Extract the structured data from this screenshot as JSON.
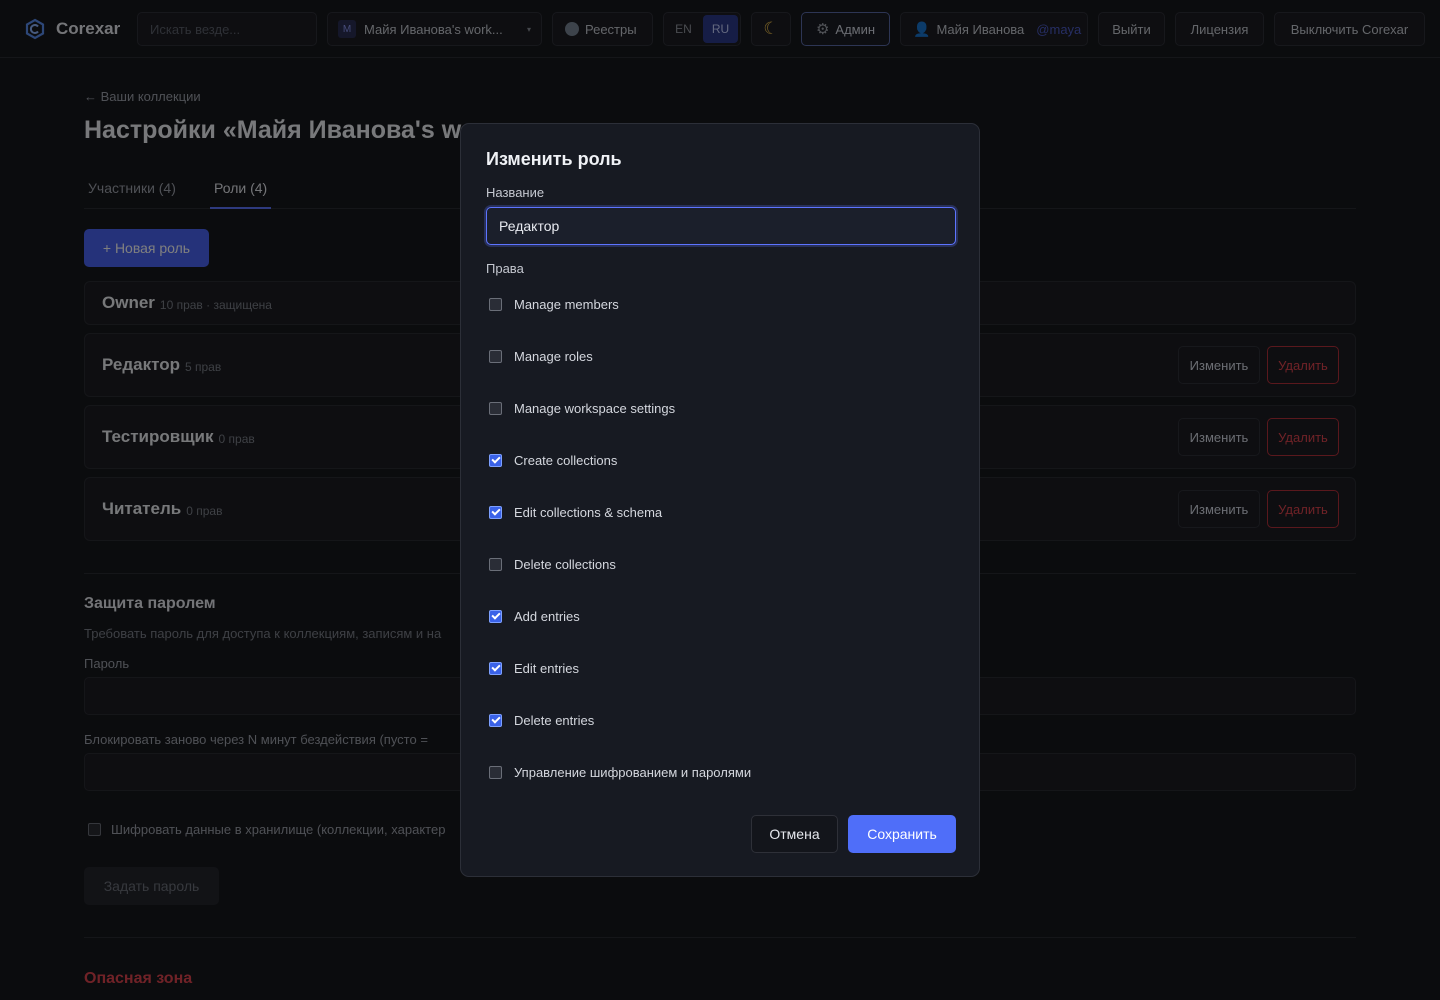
{
  "topbar": {
    "brand": "Corexar",
    "search_placeholder": "Искать везде...",
    "workspace_initial": "M",
    "workspace_name": "Майя Иванова's work...",
    "workspace_caret": "▾",
    "registries": "Реестры",
    "lang_en": "EN",
    "lang_ru": "RU",
    "theme_icon": "☾",
    "admin_icon": "⚙",
    "admin": "Админ",
    "user_icon": "👤",
    "user_name": "Майя Иванова",
    "user_handle": "@maya",
    "logout": "Выйти",
    "license": "Лицензия",
    "shutdown": "Выключить Corexar"
  },
  "page": {
    "back_link": "← Ваши коллекции",
    "title": "Настройки «Майя Иванова's w",
    "tabs": [
      {
        "label": "Участники (4)"
      },
      {
        "label": "Роли (4)"
      }
    ],
    "new_role": "+ Новая роль",
    "roles": [
      {
        "name": "Owner",
        "meta": "10 прав · защищена"
      },
      {
        "name": "Редактор",
        "meta": "5 прав",
        "edit": "Изменить",
        "delete": "Удалить"
      },
      {
        "name": "Тестировщик",
        "meta": "0 прав",
        "edit": "Изменить",
        "delete": "Удалить"
      },
      {
        "name": "Читатель",
        "meta": "0 прав",
        "edit": "Изменить",
        "delete": "Удалить"
      }
    ],
    "password_section": {
      "title": "Защита паролем",
      "desc": "Требовать пароль для доступа к коллекциям, записям и на",
      "password_label": "Пароль",
      "relock_label": "Блокировать заново через N минут бездействия (пусто =",
      "encrypt_label": "Шифровать данные в хранилище (коллекции, характер",
      "set_password": "Задать пароль"
    },
    "danger_zone": "Опасная зона"
  },
  "modal": {
    "title": "Изменить роль",
    "name_label": "Название",
    "name_value": "Редактор",
    "permissions_label": "Права",
    "permissions": [
      {
        "label": "Manage members",
        "checked": false
      },
      {
        "label": "Manage roles",
        "checked": false
      },
      {
        "label": "Manage workspace settings",
        "checked": false
      },
      {
        "label": "Create collections",
        "checked": true
      },
      {
        "label": "Edit collections & schema",
        "checked": true
      },
      {
        "label": "Delete collections",
        "checked": false
      },
      {
        "label": "Add entries",
        "checked": true
      },
      {
        "label": "Edit entries",
        "checked": true
      },
      {
        "label": "Delete entries",
        "checked": true
      },
      {
        "label": "Управление шифрованием и паролями",
        "checked": false
      }
    ],
    "cancel": "Отмена",
    "save": "Сохранить"
  }
}
